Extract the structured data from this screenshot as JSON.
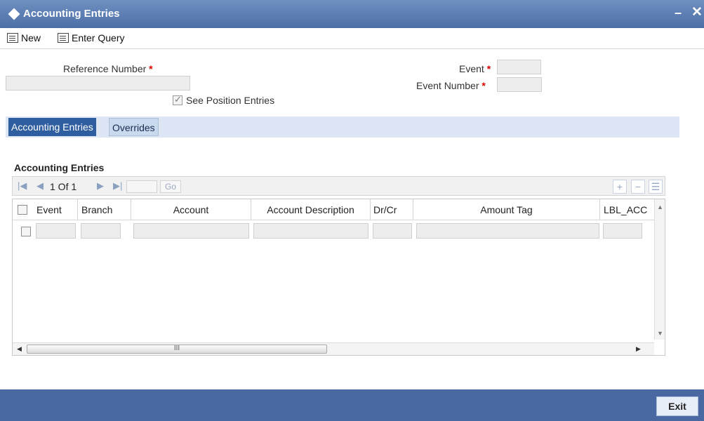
{
  "window": {
    "title": "Accounting Entries",
    "minimize": "–",
    "close": "✕"
  },
  "toolbar": {
    "new_label": "New",
    "enter_query_label": "Enter Query"
  },
  "form": {
    "reference_number_label": "Reference Number",
    "event_label": "Event",
    "event_number_label": "Event Number",
    "required_mark": "*",
    "see_position_entries_label": "See Position Entries"
  },
  "tabs": [
    {
      "label": "Accounting Entries",
      "active": true
    },
    {
      "label": "Overrides",
      "active": false
    }
  ],
  "section": {
    "title": "Accounting Entries"
  },
  "pager": {
    "page_text": "1 Of 1",
    "go_label": "Go",
    "add": "+",
    "remove": "−",
    "view": "☰"
  },
  "grid": {
    "columns": [
      "Event",
      "Branch",
      "Account",
      "Account Description",
      "Dr/Cr",
      "Amount Tag",
      "LBL_ACC"
    ],
    "scroll_thumb_label": "III"
  },
  "footer": {
    "exit_label": "Exit"
  },
  "colors": {
    "title_bar": "#4c6fa6",
    "active_tab": "#2e5ea0",
    "required": "#dd0000",
    "footer": "#4a68a2"
  }
}
